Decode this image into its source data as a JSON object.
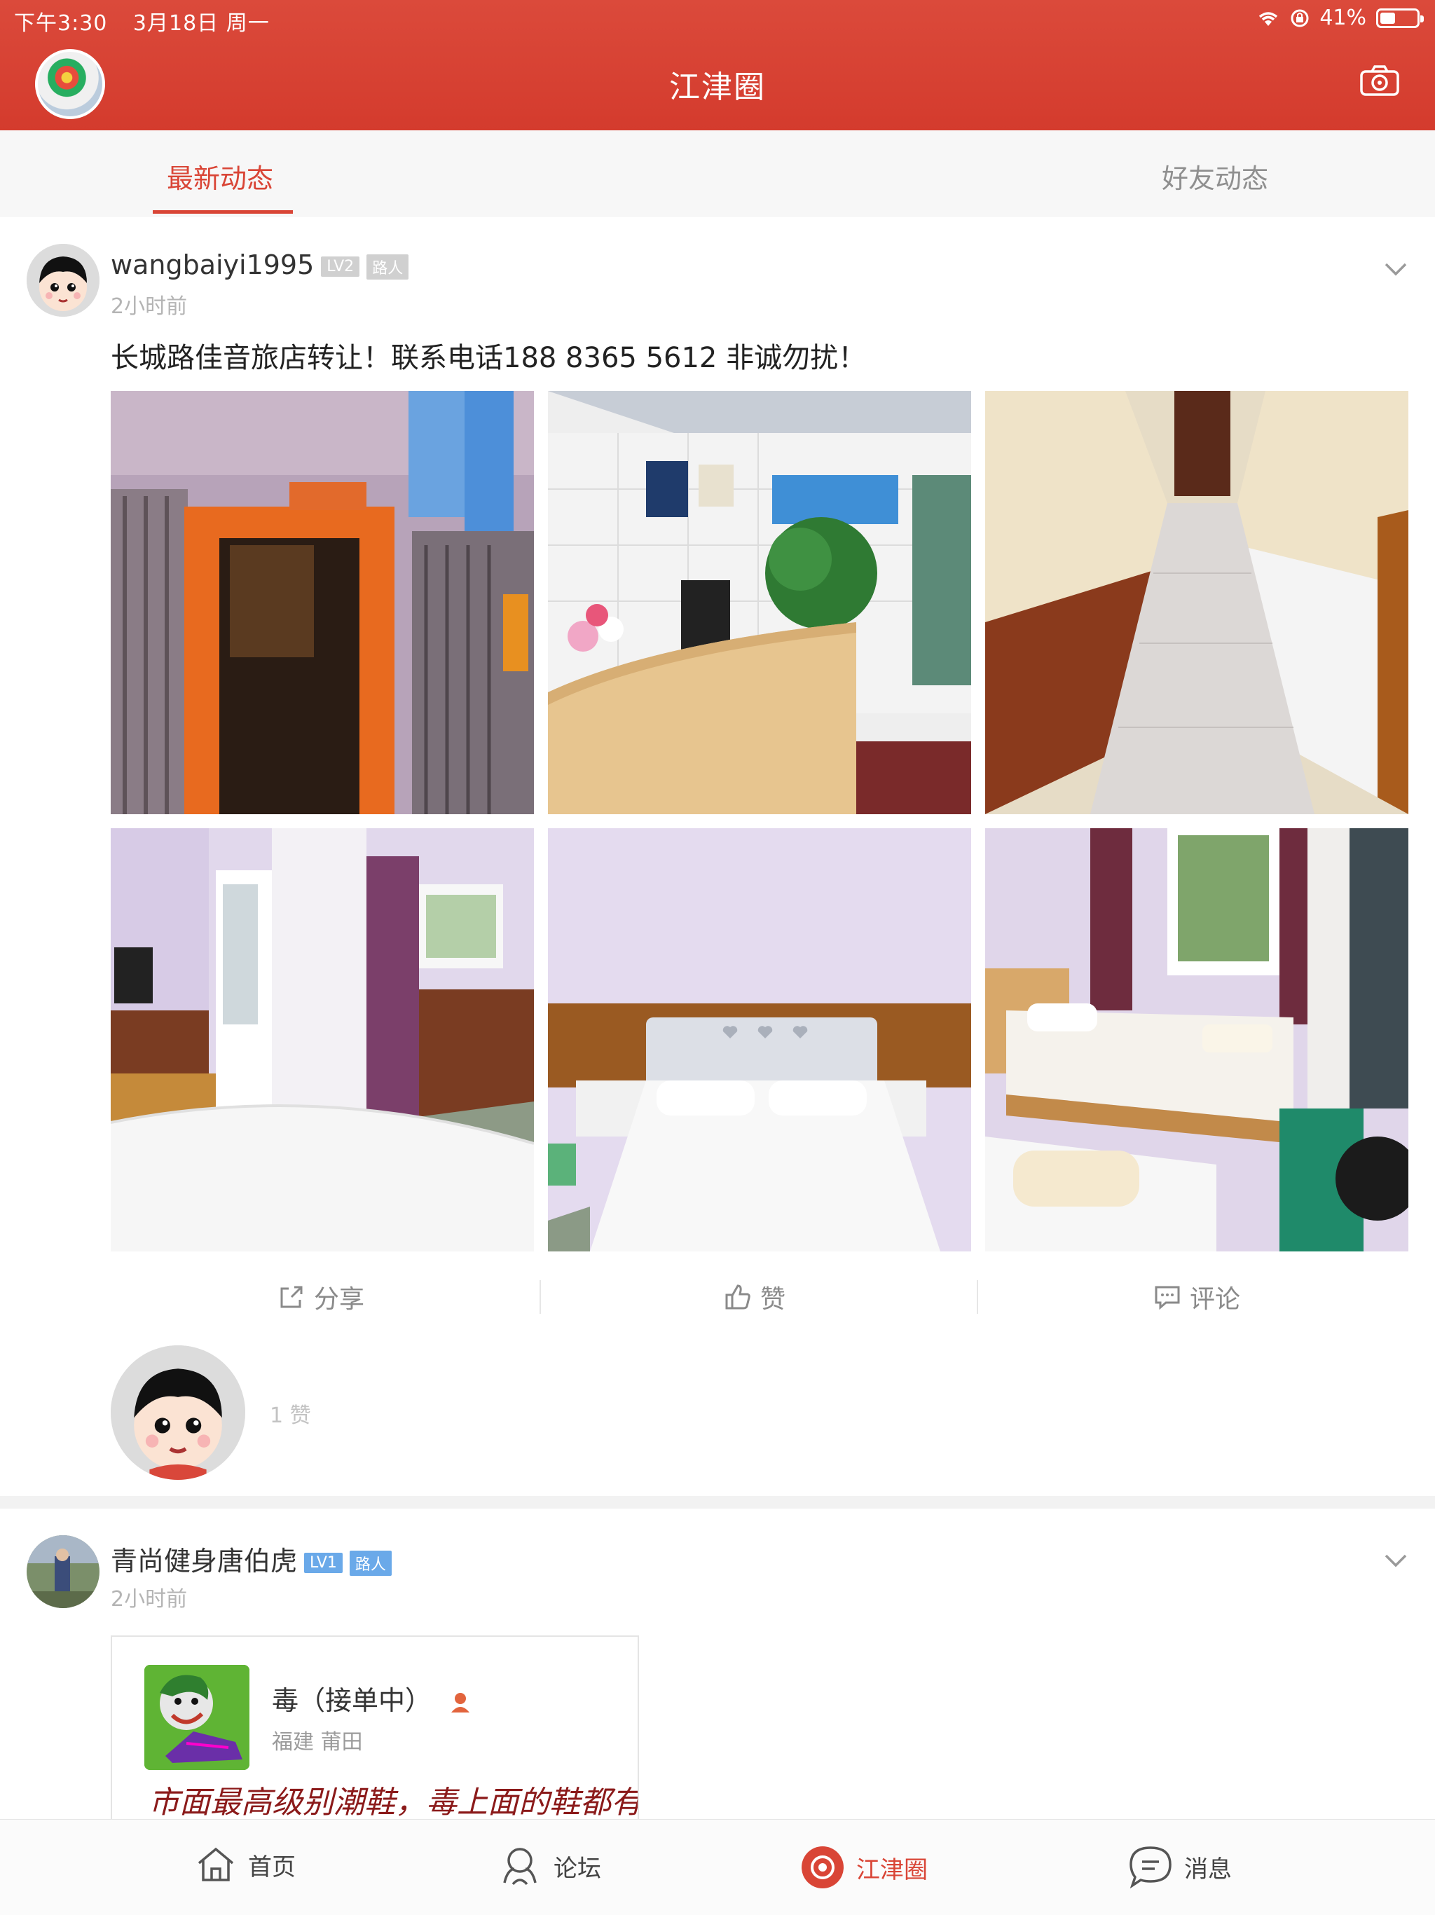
{
  "status": {
    "time": "下午3:30",
    "date": "3月18日 周一",
    "battery": "41%",
    "battery_fraction": 0.41
  },
  "header": {
    "title": "江津圈"
  },
  "tabs": [
    {
      "label": "最新动态",
      "active": true
    },
    {
      "label": "好友动态",
      "active": false
    }
  ],
  "posts": [
    {
      "username": "wangbaiyi1995",
      "badges": [
        "LV2",
        "路人"
      ],
      "time": "2小时前",
      "text": "长城路佳音旅店转让！联系电话188 8365 5612 非诚勿扰！",
      "actions": {
        "share": "分享",
        "like": "赞",
        "comment": "评论"
      },
      "like_count": "1 赞"
    },
    {
      "username": "青尚健身唐伯虎",
      "badges": [
        "LV1",
        "路人"
      ],
      "time": "2小时前",
      "card": {
        "name": "毒（接单中）",
        "location": "福建 莆田",
        "script": "市面最高级别潮鞋，毒上面的鞋都有。"
      }
    }
  ],
  "bottom_nav": [
    {
      "label": "首页",
      "icon": "home-icon"
    },
    {
      "label": "论坛",
      "icon": "forum-icon"
    },
    {
      "label": "江津圈",
      "icon": "circle-icon",
      "active": true
    },
    {
      "label": "消息",
      "icon": "message-icon"
    }
  ],
  "colors": {
    "accent": "#d94536",
    "badge_gray": "#d0d0d0",
    "badge_blue": "#6aa9e9"
  }
}
